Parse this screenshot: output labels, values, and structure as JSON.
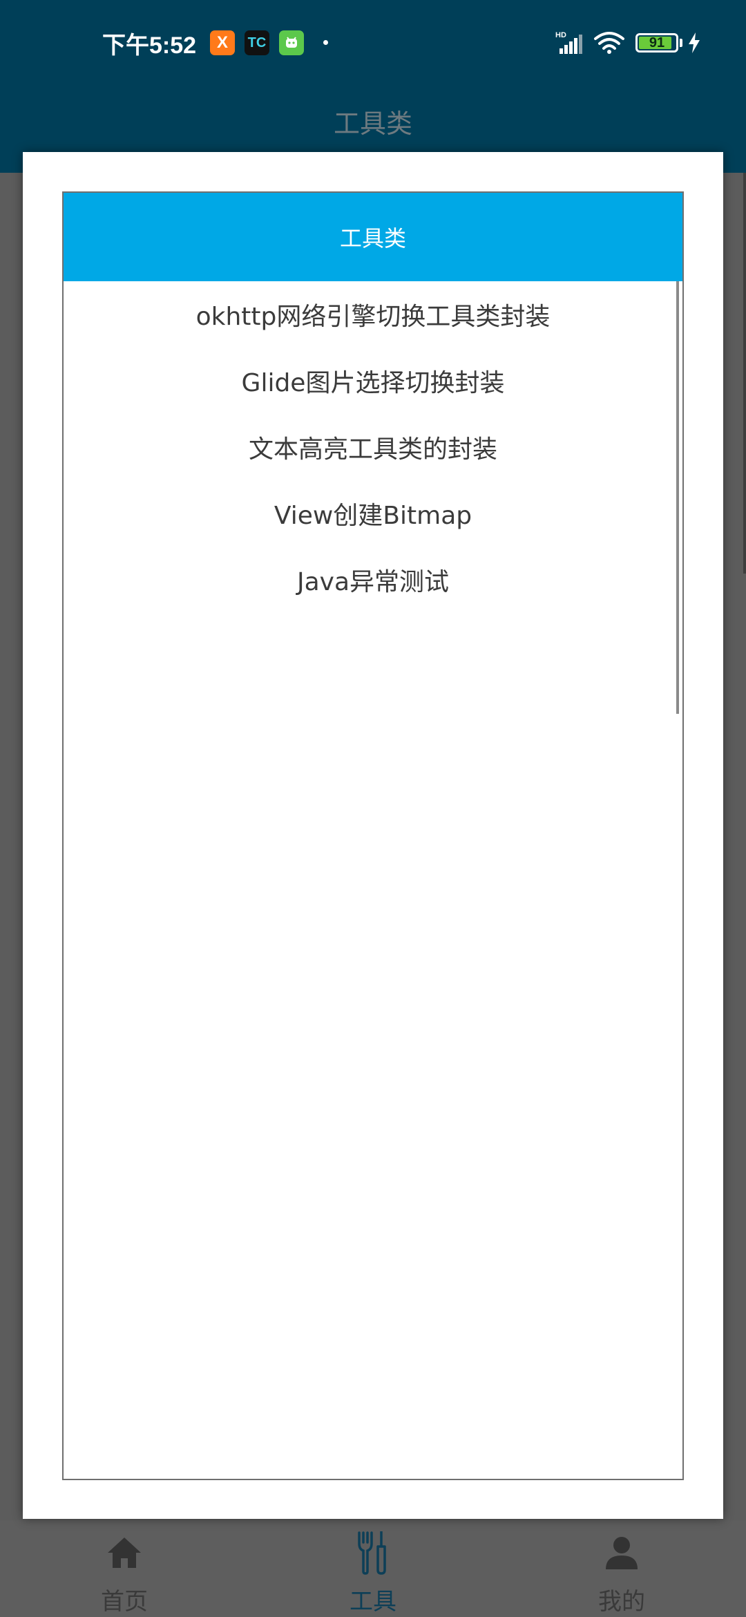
{
  "status_bar": {
    "time": "下午5:52",
    "app_icons": [
      {
        "name": "xiaomi-x-app-icon",
        "glyph": "X",
        "color": "#ff7a1a"
      },
      {
        "name": "tc-app-icon",
        "glyph": "TC",
        "color": "#111111"
      },
      {
        "name": "android-app-icon",
        "glyph": "◉",
        "color": "#5cc84b"
      }
    ],
    "network": "HD",
    "battery_level": "91",
    "battery_fraction": 0.91
  },
  "app_bar": {
    "title": "工具类"
  },
  "dialog": {
    "header": "工具类",
    "items": [
      "okhttp网络引擎切换工具类封装",
      "Glide图片选择切换封装",
      "文本高亮工具类的封装",
      "View创建Bitmap",
      "Java异常测试"
    ]
  },
  "bottom_nav": {
    "items": [
      {
        "label": "首页",
        "icon": "home-icon"
      },
      {
        "label": "工具",
        "icon": "tools-icon",
        "active": true
      },
      {
        "label": "我的",
        "icon": "person-icon"
      }
    ]
  },
  "colors": {
    "status_bar_bg": "#003f58",
    "dialog_header_bg": "#00a8e6",
    "active_tab": "#0d3f57"
  }
}
